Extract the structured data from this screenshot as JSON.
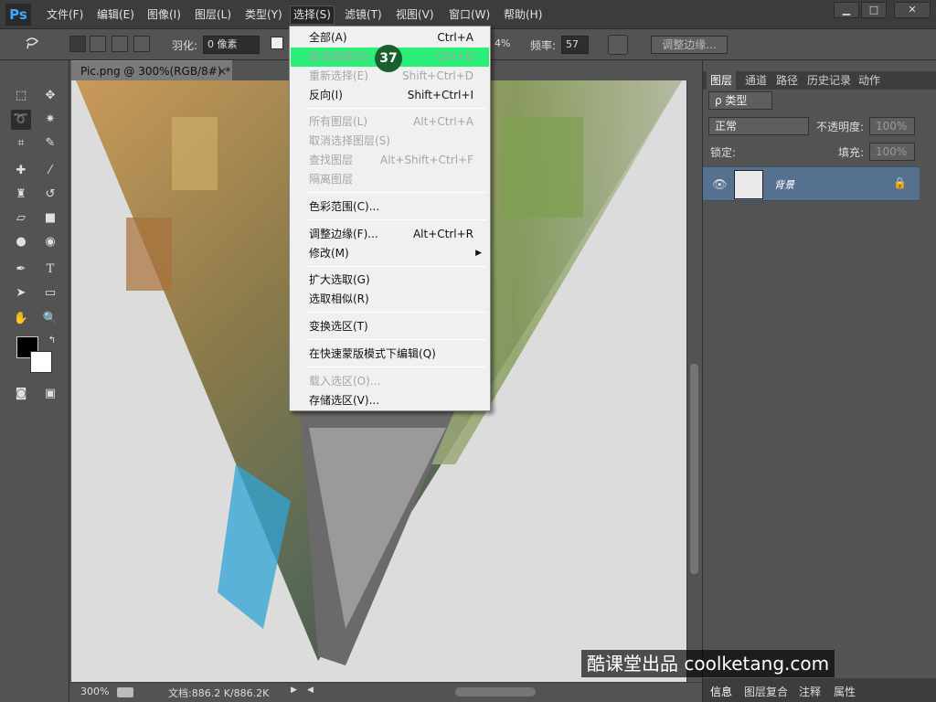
{
  "app": {
    "logo": "Ps"
  },
  "menubar": {
    "items": [
      "文件(F)",
      "编辑(E)",
      "图像(I)",
      "图层(L)",
      "类型(Y)",
      "选择(S)",
      "滤镜(T)",
      "视图(V)",
      "窗口(W)",
      "帮助(H)"
    ],
    "active": "选择(S)"
  },
  "window_controls": {
    "minimize": "▁",
    "maximize": "□",
    "close": "✕"
  },
  "options": {
    "feather_label": "羽化:",
    "feather_value": "0 像素",
    "width_value": "4%",
    "frequency_label": "频率:",
    "frequency_value": "57",
    "refine_edge_button": "调整边缘..."
  },
  "document": {
    "tab_title": "Pic.png @ 300%(RGB/8#) *",
    "tab_close": "×",
    "zoom": "300%",
    "doc_size": "文档:886.2 K/886.2K"
  },
  "panels": {
    "tabs": [
      "图层",
      "通道",
      "路径",
      "历史记录",
      "动作"
    ],
    "kind_label": "ρ 类型",
    "blend_mode": "正常",
    "opacity_label": "不透明度:",
    "opacity_value": "100%",
    "lock_label": "锁定:",
    "fill_label": "填充:",
    "fill_value": "100%",
    "layer_name": "背景",
    "bottom_tabs": [
      "信息",
      "图层复合",
      "注释",
      "属性"
    ]
  },
  "select_menu": {
    "items": [
      {
        "label": "全部(A)",
        "shortcut": "Ctrl+A",
        "enabled": true
      },
      {
        "label": "取消选择(D)",
        "shortcut": "Ctrl+D",
        "enabled": false,
        "highlighted": true
      },
      {
        "label": "重新选择(E)",
        "shortcut": "Shift+Ctrl+D",
        "enabled": false
      },
      {
        "label": "反向(I)",
        "shortcut": "Shift+Ctrl+I",
        "enabled": true
      },
      {
        "label": "所有图层(L)",
        "shortcut": "Alt+Ctrl+A",
        "enabled": false
      },
      {
        "label": "取消选择图层(S)",
        "shortcut": "",
        "enabled": false
      },
      {
        "label": "查找图层",
        "shortcut": "Alt+Shift+Ctrl+F",
        "enabled": false
      },
      {
        "label": "隔离图层",
        "shortcut": "",
        "enabled": false
      },
      {
        "label": "色彩范围(C)...",
        "shortcut": "",
        "enabled": true
      },
      {
        "label": "调整边缘(F)...",
        "shortcut": "Alt+Ctrl+R",
        "enabled": true
      },
      {
        "label": "修改(M)",
        "shortcut": "",
        "enabled": true,
        "submenu": true
      },
      {
        "label": "扩大选取(G)",
        "shortcut": "",
        "enabled": true
      },
      {
        "label": "选取相似(R)",
        "shortcut": "",
        "enabled": true
      },
      {
        "label": "变换选区(T)",
        "shortcut": "",
        "enabled": true
      },
      {
        "label": "在快速蒙版模式下编辑(Q)",
        "shortcut": "",
        "enabled": true
      },
      {
        "label": "载入选区(O)...",
        "shortcut": "",
        "enabled": false
      },
      {
        "label": "存储选区(V)...",
        "shortcut": "",
        "enabled": true
      }
    ],
    "step_badge": "37"
  },
  "watermark": "酷课堂出品 coolketang.com",
  "colors": {
    "highlight": "#2bef78",
    "badge": "#1a5f2e",
    "layer_selected": "#56708f"
  }
}
